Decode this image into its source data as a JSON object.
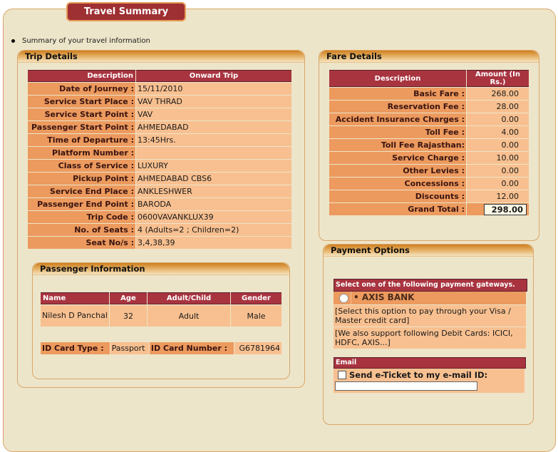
{
  "page": {
    "title": "Travel Summary",
    "summary_text": "Summary of your travel information"
  },
  "trip_details": {
    "title": "Trip Details",
    "headers": [
      "Description",
      "Onward Trip"
    ],
    "rows": [
      {
        "label": "Date of Journey :",
        "value": "15/11/2010"
      },
      {
        "label": "Service Start Place :",
        "value": "VAV THRAD"
      },
      {
        "label": "Service Start Point :",
        "value": "VAV"
      },
      {
        "label": "Passenger Start Point :",
        "value": "AHMEDABAD"
      },
      {
        "label": "Time of Departure :",
        "value": "13:45Hrs."
      },
      {
        "label": "Platform Number :",
        "value": ""
      },
      {
        "label": "Class of Service :",
        "value": "LUXURY"
      },
      {
        "label": "Pickup Point :",
        "value": "AHMEDABAD CBS6"
      },
      {
        "label": "Service End Place :",
        "value": "ANKLESHWER"
      },
      {
        "label": "Passenger End Point :",
        "value": "BARODA"
      },
      {
        "label": "Trip Code :",
        "value": "0600VAVANKLUX39"
      },
      {
        "label": "No. of Seats :",
        "value": "4 (Adults=2 ; Children=2)"
      },
      {
        "label": "Seat No/s :",
        "value": "3,4,38,39"
      }
    ]
  },
  "passenger_info": {
    "title": "Passenger Information",
    "headers": [
      "Name",
      "Age",
      "Adult/Child",
      "Gender"
    ],
    "passengers": [
      {
        "name": "Nilesh D Panchal",
        "age": "32",
        "type": "Adult",
        "gender": "Male"
      }
    ],
    "id_card_type_label": "ID Card Type :",
    "id_card_type": "Passport",
    "id_card_number_label": "ID Card Number :",
    "id_card_number": "G6781964"
  },
  "fare_details": {
    "title": "Fare Details",
    "headers": [
      "Description",
      "Amount (In Rs.)"
    ],
    "rows": [
      {
        "label": "Basic Fare :",
        "value": "268.00"
      },
      {
        "label": "Reservation Fee :",
        "value": "28.00"
      },
      {
        "label": "Accident Insurance Charges :",
        "value": "0.00"
      },
      {
        "label": "Toll Fee :",
        "value": "4.00"
      },
      {
        "label": "Toll Fee Rajasthan:",
        "value": "0.00"
      },
      {
        "label": "Service Charge :",
        "value": "10.00"
      },
      {
        "label": "Other Levies :",
        "value": "0.00"
      },
      {
        "label": "Concessions :",
        "value": "0.00"
      },
      {
        "label": "Discounts :",
        "value": "12.00"
      }
    ],
    "grand_total_label": "Grand Total :",
    "grand_total": "298.00"
  },
  "payment_options": {
    "title": "Payment Options",
    "header": "Select one of the following payment gateways.",
    "gateway_label": "• AXIS BANK",
    "note1": "[Select this option to pay through your Visa / Master credit card]",
    "note2": "[We also support following Debit Cards: ICICI, HDFC, AXIS...]",
    "email_header": "Email",
    "email_checkbox_label": "Send e-Ticket to my e-mail ID:",
    "email_value": ""
  },
  "colors": {
    "header_bg": "#a8343f",
    "label_bg": "#ec9a5e",
    "value_bg": "#f8c090",
    "page_bg": "#ede5c9"
  }
}
